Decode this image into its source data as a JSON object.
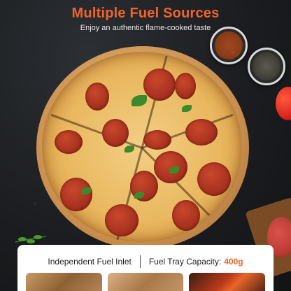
{
  "header": {
    "title": "Multiple Fuel Sources",
    "subtitle": "Enjoy an authentic flame-cooked taste"
  },
  "specs": {
    "inlet_label": "Independent Fuel Inlet",
    "capacity_label": "Fuel Tray Capacity:",
    "capacity_value": "400g"
  },
  "colors": {
    "accent": "#f0642a",
    "panel": "#ffffff",
    "background": "#1b1d20"
  }
}
